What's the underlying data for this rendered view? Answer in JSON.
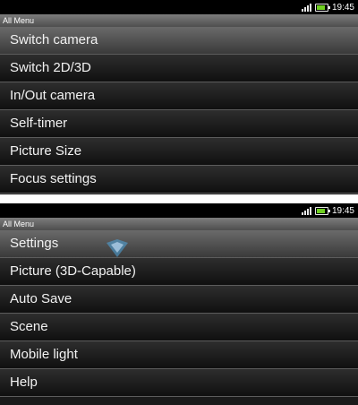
{
  "screens": [
    {
      "status": {
        "time": "19:45",
        "signal_icon": "signal-bars-icon",
        "battery_icon": "battery-icon"
      },
      "title": "All Menu",
      "items": [
        {
          "label": "Switch camera"
        },
        {
          "label": "Switch 2D/3D"
        },
        {
          "label": "In/Out camera"
        },
        {
          "label": "Self-timer"
        },
        {
          "label": "Picture Size"
        },
        {
          "label": "Focus settings"
        }
      ]
    },
    {
      "status": {
        "time": "19:45",
        "signal_icon": "signal-bars-icon",
        "battery_icon": "battery-icon"
      },
      "title": "All Menu",
      "items": [
        {
          "label": "Settings"
        },
        {
          "label": "Picture (3D-Capable)"
        },
        {
          "label": "Auto Save"
        },
        {
          "label": "Scene"
        },
        {
          "label": "Mobile light"
        },
        {
          "label": "Help"
        }
      ]
    }
  ],
  "colors": {
    "battery_fill": "#6fd020",
    "title_bar": "#6a6a6a",
    "item_bg": "#1c1c1c"
  }
}
